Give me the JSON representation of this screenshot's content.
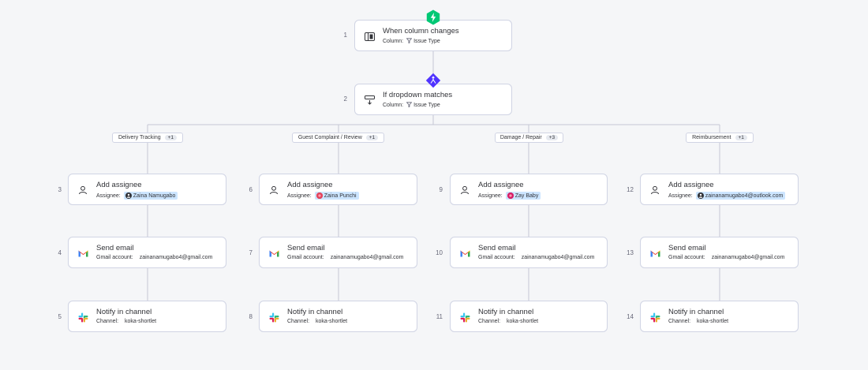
{
  "trigger": {
    "number": "1",
    "title": "When column changes",
    "meta_label": "Column:",
    "meta_value": "Issue Type",
    "icon": "column-icon",
    "badge_icon": "lightning-icon",
    "badge_color": "#00c875"
  },
  "condition": {
    "number": "2",
    "title": "If dropdown matches",
    "meta_label": "Column:",
    "meta_value": "Issue Type",
    "icon": "dropdown-icon",
    "badge_icon": "branch-icon",
    "badge_color": "#5034ff"
  },
  "branches": [
    {
      "label": "Delivery Tracking",
      "more": "+1",
      "assign": {
        "number": "3",
        "title": "Add assignee",
        "meta_label": "Assignee:",
        "person": "Zaina Namugabo",
        "avatar_color": "#323338",
        "avatar_type": "user-icon"
      },
      "email": {
        "number": "4",
        "title": "Send email",
        "meta_label": "Gmail account:",
        "value": "zainanamugabo4@gmail.com"
      },
      "notify": {
        "number": "5",
        "title": "Notify in channel",
        "meta_label": "Channel:",
        "value": "koka-shortlet"
      }
    },
    {
      "label": "Guest Complaint / Review",
      "more": "+1",
      "assign": {
        "number": "6",
        "title": "Add assignee",
        "meta_label": "Assignee:",
        "person": "Zaina Punchi",
        "avatar_color": "#e2445c",
        "avatar_type": "initials",
        "initials": "ZP"
      },
      "email": {
        "number": "7",
        "title": "Send email",
        "meta_label": "Gmail account:",
        "value": "zainanamugabo4@gmail.com"
      },
      "notify": {
        "number": "8",
        "title": "Notify in channel",
        "meta_label": "Channel:",
        "value": "koka-shortlet"
      }
    },
    {
      "label": "Damage / Repair",
      "more": "+3",
      "assign": {
        "number": "9",
        "title": "Add assignee",
        "meta_label": "Assignee:",
        "person": "Zay Baby",
        "avatar_color": "#e2445c",
        "avatar_type": "initials",
        "initials": "ZB"
      },
      "email": {
        "number": "10",
        "title": "Send email",
        "meta_label": "Gmail account:",
        "value": "zainanamugabo4@gmail.com"
      },
      "notify": {
        "number": "11",
        "title": "Notify in channel",
        "meta_label": "Channel:",
        "value": "koka-shortlet"
      }
    },
    {
      "label": "Reimbursement",
      "more": "+1",
      "assign": {
        "number": "12",
        "title": "Add assignee",
        "meta_label": "Assignee:",
        "person": "zainanamugabo4@outlook.com",
        "avatar_color": "#323338",
        "avatar_type": "user-icon"
      },
      "email": {
        "number": "13",
        "title": "Send email",
        "meta_label": "Gmail account:",
        "value": "zainanamugabo4@gmail.com"
      },
      "notify": {
        "number": "14",
        "title": "Notify in channel",
        "meta_label": "Channel:",
        "value": "koka-shortlet"
      }
    }
  ],
  "icons": {
    "assign": "person-icon",
    "email": "gmail-icon",
    "notify": "slack-icon",
    "column_meta": "filter-icon"
  },
  "colors": {
    "line": "#c5c7d4",
    "card_border": "#d0d4e4",
    "chip_bg": "#cce5ff"
  }
}
